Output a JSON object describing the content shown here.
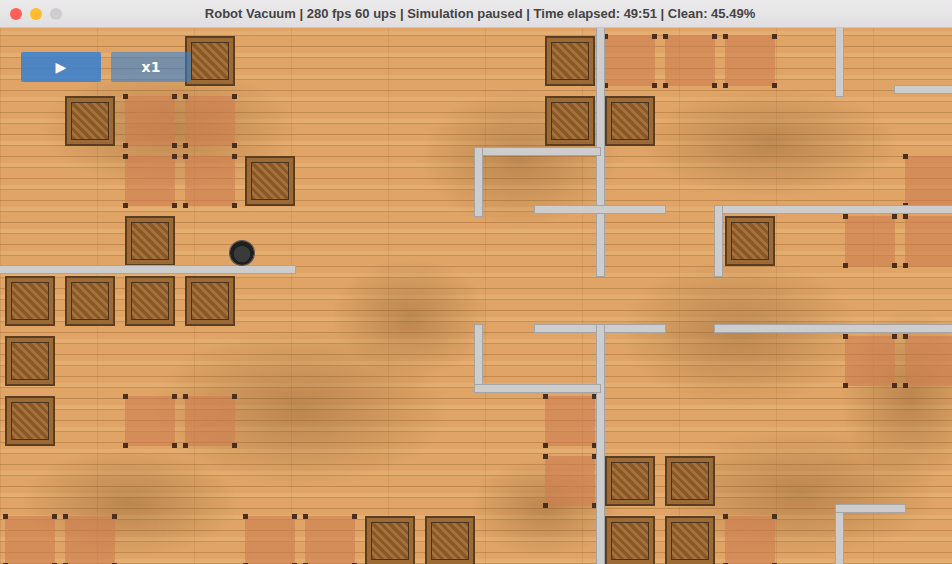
{
  "window": {
    "title": "Robot Vacuum | 280 fps 60 ups | Simulation paused | Time elapsed: 49:51 | Clean: 45.49%",
    "controls": [
      {
        "color": "#ff5f57"
      },
      {
        "color": "#febc2e"
      },
      {
        "color": "#cfcdcf"
      }
    ]
  },
  "toolbar": {
    "buttons": [
      {
        "label": "▶",
        "kind": "play"
      },
      {
        "label": "x1",
        "kind": "speed"
      }
    ]
  },
  "simulation": {
    "paused": true
  }
}
